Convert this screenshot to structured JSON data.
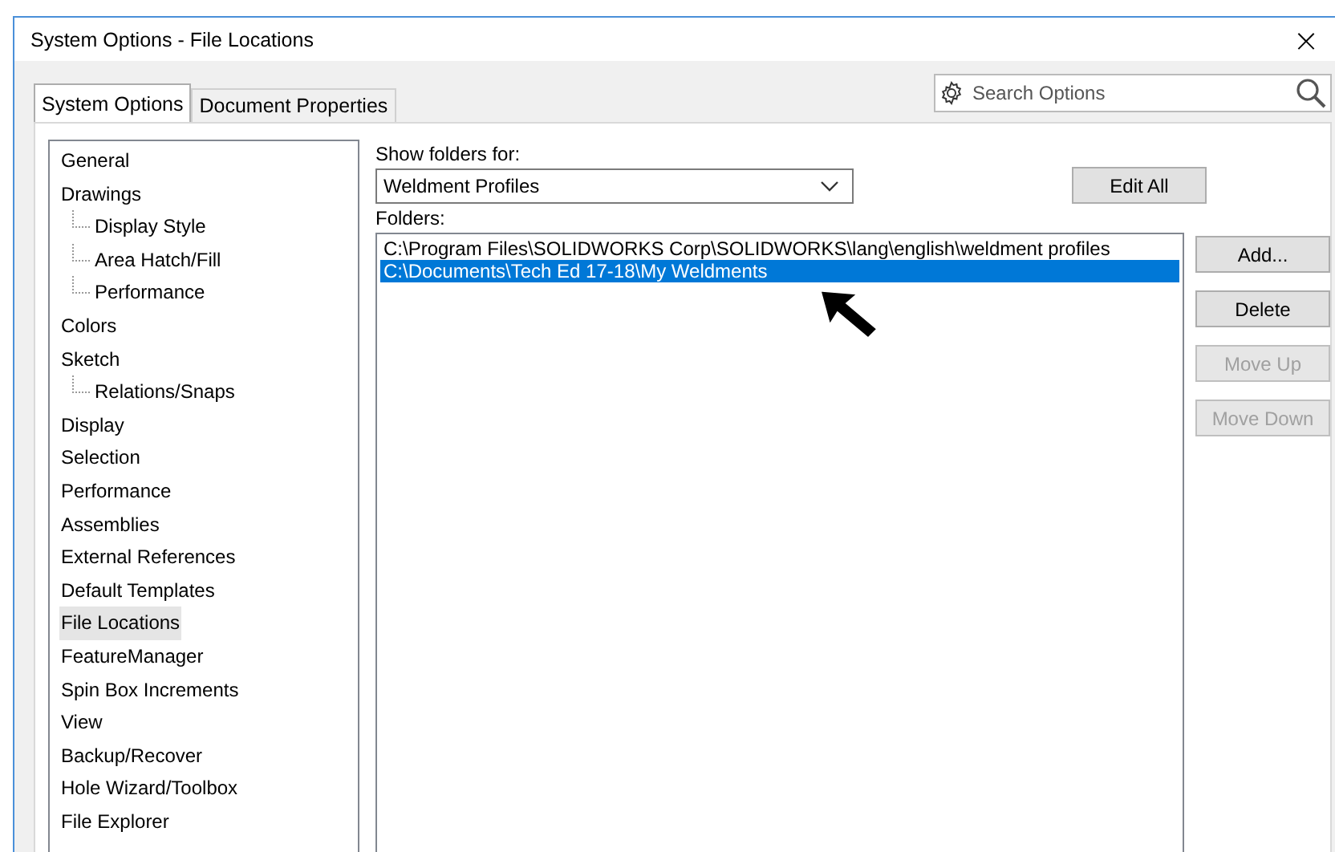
{
  "window": {
    "title": "System Options - File Locations",
    "close": "×"
  },
  "tabs": [
    {
      "label": "System Options",
      "selected": true
    },
    {
      "label": "Document Properties",
      "selected": false
    }
  ],
  "search": {
    "placeholder": "Search Options"
  },
  "tree": [
    {
      "label": "General",
      "selected": false
    },
    {
      "label": "Drawings",
      "selected": false,
      "children": [
        {
          "label": "Display Style",
          "selected": false
        },
        {
          "label": "Area Hatch/Fill",
          "selected": false
        },
        {
          "label": "Performance",
          "selected": false
        }
      ]
    },
    {
      "label": "Colors",
      "selected": false
    },
    {
      "label": "Sketch",
      "selected": false,
      "children": [
        {
          "label": "Relations/Snaps",
          "selected": false
        }
      ]
    },
    {
      "label": "Display",
      "selected": false
    },
    {
      "label": "Selection",
      "selected": false
    },
    {
      "label": "Performance",
      "selected": false
    },
    {
      "label": "Assemblies",
      "selected": false
    },
    {
      "label": "External References",
      "selected": false
    },
    {
      "label": "Default Templates",
      "selected": false
    },
    {
      "label": "File Locations",
      "selected": true
    },
    {
      "label": "FeatureManager",
      "selected": false
    },
    {
      "label": "Spin Box Increments",
      "selected": false
    },
    {
      "label": "View",
      "selected": false
    },
    {
      "label": "Backup/Recover",
      "selected": false
    },
    {
      "label": "Hole Wizard/Toolbox",
      "selected": false
    },
    {
      "label": "File Explorer",
      "selected": false
    }
  ],
  "show_folders_for": {
    "label": "Show folders for:",
    "value": "Weldment Profiles"
  },
  "edit_all_button": {
    "label": "Edit All",
    "disabled": false
  },
  "folders": {
    "label": "Folders:",
    "items": [
      {
        "path": "C:\\Program Files\\SOLIDWORKS Corp\\SOLIDWORKS\\lang\\english\\weldment profiles",
        "selected": false
      },
      {
        "path": "C:\\Documents\\Tech Ed 17-18\\My Weldments",
        "selected": true
      }
    ]
  },
  "buttons": [
    {
      "label": "Add...",
      "disabled": false
    },
    {
      "label": "Delete",
      "disabled": false
    },
    {
      "label": "Move Up",
      "disabled": true
    },
    {
      "label": "Move Down",
      "disabled": true
    }
  ]
}
